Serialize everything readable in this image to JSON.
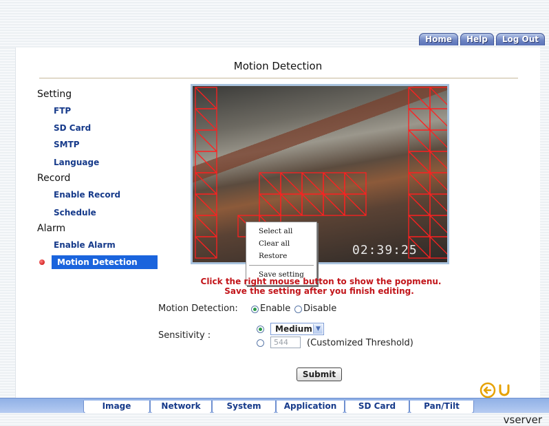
{
  "header": {
    "nav": [
      "Home",
      "Help",
      "Log Out"
    ]
  },
  "page": {
    "title": "Motion Detection"
  },
  "sidebar": {
    "sections": [
      {
        "heading": "Setting",
        "items": [
          "FTP",
          "SD Card",
          "SMTP",
          "Language"
        ]
      },
      {
        "heading": "Record",
        "items": [
          "Enable Record",
          "Schedule"
        ]
      },
      {
        "heading": "Alarm",
        "items": [
          "Enable Alarm",
          "Motion Detection"
        ]
      }
    ],
    "active_item": "Motion Detection"
  },
  "video": {
    "timestamp": "02:39:25"
  },
  "popmenu": {
    "items": [
      "Select all",
      "Clear all",
      "Restore",
      "Save setting"
    ]
  },
  "hints": {
    "line1": "Click the right mouse button to show the popmenu.",
    "line2": "Save the setting after you finish editing."
  },
  "form": {
    "motion_label": "Motion Detection:",
    "enable_label": "Enable",
    "disable_label": "Disable",
    "motion_value": "Enable",
    "sensitivity_label": "Sensitivity :",
    "sensitivity_value": "Medium",
    "threshold_value": "544",
    "threshold_label": "(Customized Threshold)",
    "submit_label": "Submit"
  },
  "bottom_nav": [
    "Image",
    "Network",
    "System",
    "Application",
    "SD Card",
    "Pan/Tilt"
  ],
  "footer": {
    "brand": "vserver"
  },
  "colors": {
    "accent": "#1a64dd",
    "link": "#163a8a",
    "hint": "#c2151a",
    "grid": "#e0101a"
  },
  "icons": [
    "back-arrow-icon",
    "refresh-icon",
    "chevron-down-icon"
  ]
}
